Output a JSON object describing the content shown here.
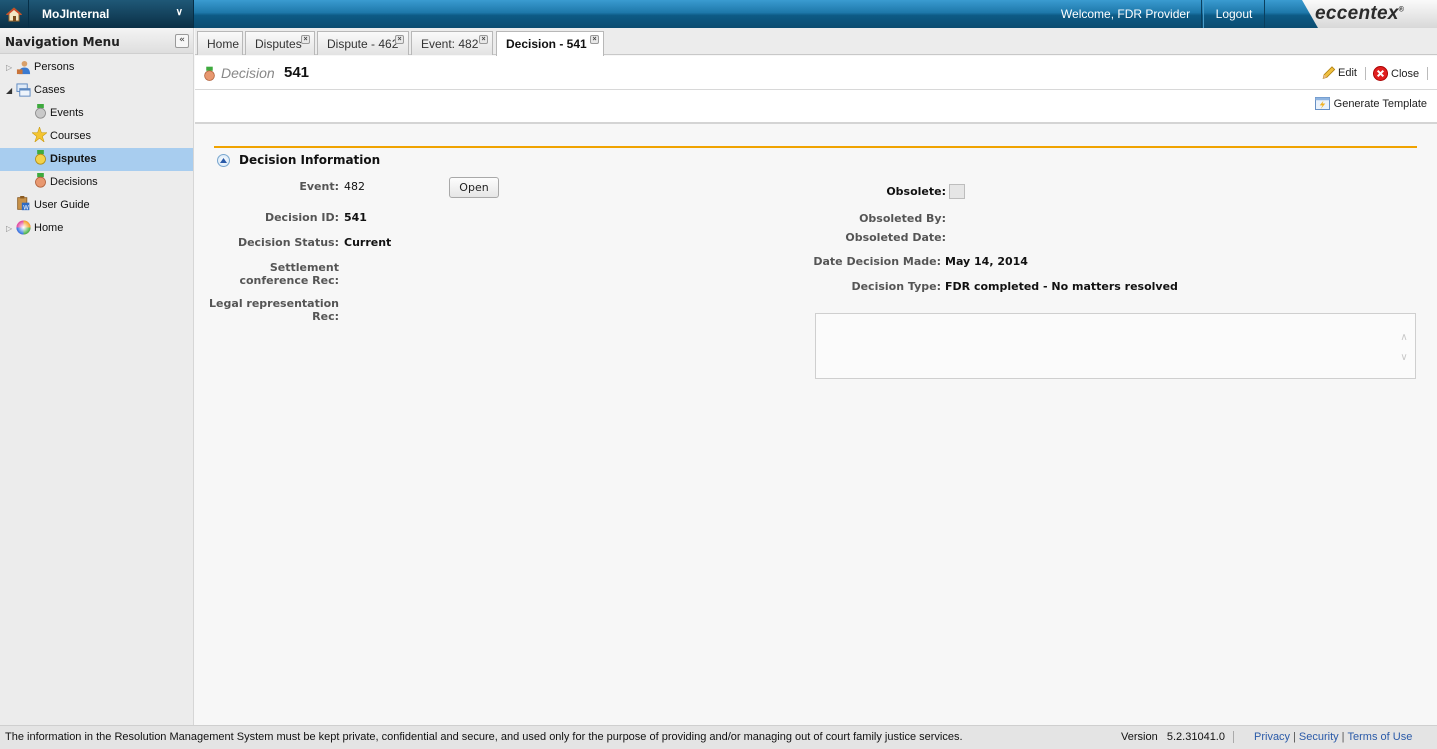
{
  "header": {
    "app_name": "MoJInternal",
    "welcome": "Welcome, FDR Provider",
    "logout": "Logout",
    "logo": "eccentex",
    "logo_mark": "®"
  },
  "sidebar": {
    "title": "Navigation Menu",
    "collapse_glyph": "«",
    "items": [
      {
        "label": "Persons",
        "icon": "persons-icon",
        "expander": "collapsed"
      },
      {
        "label": "Cases",
        "icon": "cases-icon",
        "expander": "expanded"
      },
      {
        "label": "Events",
        "icon": "medal-gray-icon"
      },
      {
        "label": "Courses",
        "icon": "star-icon"
      },
      {
        "label": "Disputes",
        "icon": "medal-gold-icon",
        "selected": true
      },
      {
        "label": "Decisions",
        "icon": "medal-bronze-icon"
      },
      {
        "label": "User Guide",
        "icon": "word-doc-icon"
      },
      {
        "label": "Home",
        "icon": "color-wheel-icon",
        "expander": "collapsed"
      }
    ]
  },
  "tabs": [
    {
      "label": "Home",
      "closable": false
    },
    {
      "label": "Disputes",
      "closable": true
    },
    {
      "label": "Dispute - 462",
      "closable": true
    },
    {
      "label": "Event: 482",
      "closable": true
    },
    {
      "label": "Decision - 541",
      "closable": true,
      "active": true
    }
  ],
  "record": {
    "type": "Decision",
    "id": "541",
    "actions": {
      "edit": "Edit",
      "close": "Close",
      "generate_template": "Generate Template"
    }
  },
  "section": {
    "title": "Decision Information",
    "left_fields": [
      {
        "label": "Event:",
        "value": "482"
      },
      {
        "label": "Decision ID:",
        "value": "541"
      },
      {
        "label": "Decision Status:",
        "value": "Current"
      },
      {
        "label": "Settlement conference Rec:",
        "value": ""
      },
      {
        "label": "Legal representation Rec:",
        "value": ""
      }
    ],
    "open_button": "Open",
    "right_fields": [
      {
        "label": "Obsolete:",
        "value": false
      },
      {
        "label": "Obsoleted By:",
        "value": ""
      },
      {
        "label": "Obsoleted Date:",
        "value": ""
      },
      {
        "label": "Date Decision Made:",
        "value": "May 14, 2014"
      },
      {
        "label": "Decision Type:",
        "value": "FDR completed - No matters resolved"
      }
    ],
    "notes_value": ""
  },
  "footer": {
    "message": "The information in the Resolution Management System must be kept private, confidential and secure, and used only for the purpose of providing and/or managing out of court family justice services.",
    "version_label": "Version",
    "version": "5.2.31041.0",
    "links": [
      "Privacy",
      "Security",
      "Terms of Use"
    ]
  },
  "colors": {
    "header_blue": "#1e78aa",
    "selected_nav": "#a8cdef",
    "section_rule": "#f0a300",
    "link": "#2a5aa8"
  }
}
